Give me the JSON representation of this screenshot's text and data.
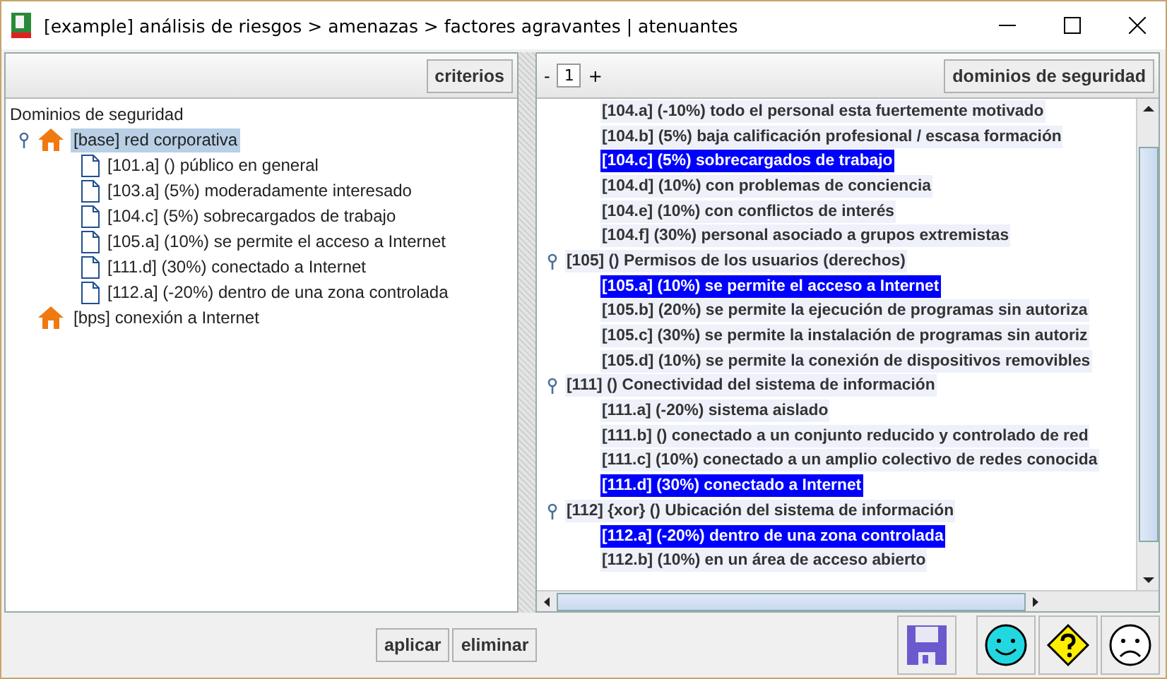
{
  "window": {
    "title": "[example] análisis de riesgos > amenazas > factores agravantes | atenuantes"
  },
  "left_panel": {
    "button": "criterios",
    "tree": {
      "root": "Dominios de seguridad",
      "nodes": [
        {
          "label": "[base] red corporativa",
          "selected": true,
          "expanded": true,
          "children": [
            {
              "label": "[101.a] () público en general"
            },
            {
              "label": "[103.a] (5%) moderadamente interesado"
            },
            {
              "label": "[104.c] (5%) sobrecargados de trabajo"
            },
            {
              "label": "[105.a] (10%) se permite el acceso a Internet"
            },
            {
              "label": "[111.d] (30%) conectado a Internet"
            },
            {
              "label": "[112.a] (-20%) dentro de una zona controlada"
            }
          ]
        },
        {
          "label": "[bps] conexión a Internet",
          "selected": false,
          "expanded": false
        }
      ]
    }
  },
  "right_panel": {
    "page_field": {
      "minus": "-",
      "value": "1",
      "plus": "+"
    },
    "button": "dominios de seguridad",
    "rows": [
      {
        "kind": "item",
        "label": "[104.a] (-10%) todo el personal esta fuertemente motivado",
        "selected": false
      },
      {
        "kind": "item",
        "label": "[104.b] (5%) baja calificación profesional / escasa formación",
        "selected": false
      },
      {
        "kind": "item",
        "label": "[104.c] (5%) sobrecargados de trabajo",
        "selected": true
      },
      {
        "kind": "item",
        "label": "[104.d] (10%) con problemas de conciencia",
        "selected": false
      },
      {
        "kind": "item",
        "label": "[104.e] (10%) con conflictos de interés",
        "selected": false
      },
      {
        "kind": "item",
        "label": "[104.f] (30%) personal asociado a grupos extremistas",
        "selected": false
      },
      {
        "kind": "group",
        "label": "[105] () Permisos de los usuarios (derechos)",
        "expanded": true
      },
      {
        "kind": "item",
        "label": "[105.a] (10%) se permite el acceso a Internet",
        "selected": true
      },
      {
        "kind": "item",
        "label": "[105.b] (20%) se permite la ejecución de programas sin autoriza",
        "selected": false
      },
      {
        "kind": "item",
        "label": "[105.c] (30%) se permite la instalación de programas sin autoriz",
        "selected": false
      },
      {
        "kind": "item",
        "label": "[105.d] (10%) se permite la conexión de dispositivos removibles",
        "selected": false
      },
      {
        "kind": "group",
        "label": "[111] () Conectividad del sistema de información",
        "expanded": true
      },
      {
        "kind": "item",
        "label": "[111.a] (-20%) sistema aislado",
        "selected": false
      },
      {
        "kind": "item",
        "label": "[111.b] () conectado a un conjunto reducido y controlado de red",
        "selected": false
      },
      {
        "kind": "item",
        "label": "[111.c] (10%) conectado a un amplio colectivo de redes conocida",
        "selected": false
      },
      {
        "kind": "item",
        "label": "[111.d] (30%) conectado a Internet",
        "selected": true
      },
      {
        "kind": "group",
        "label": "[112] {xor} () Ubicación del sistema de información",
        "expanded": true
      },
      {
        "kind": "item",
        "label": "[112.a] (-20%) dentro de una zona controlada",
        "selected": true
      },
      {
        "kind": "item",
        "label": "[112.b] (10%) en un área de acceso abierto",
        "selected": false
      }
    ]
  },
  "buttons": [
    "aplicar",
    "eliminar"
  ]
}
